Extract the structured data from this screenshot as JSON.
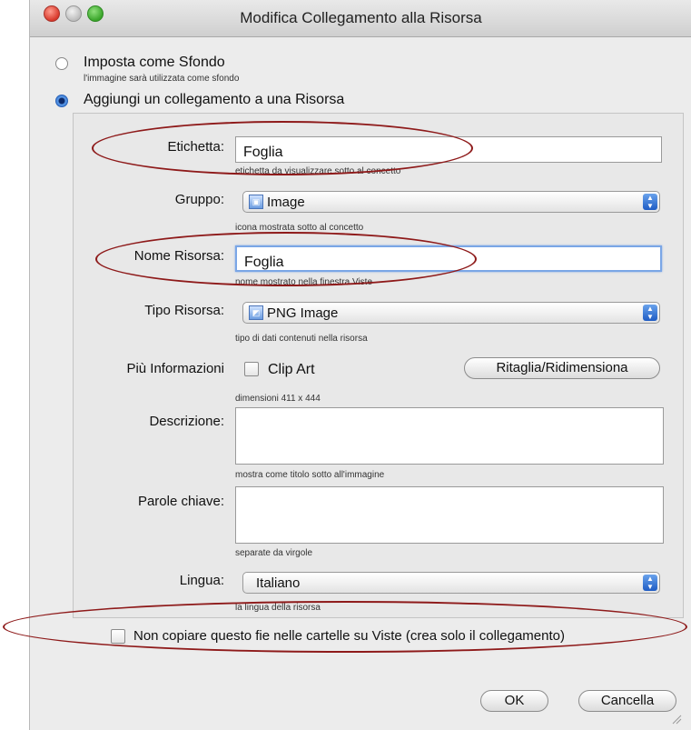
{
  "window": {
    "title": "Modifica Collegamento alla Risorsa"
  },
  "mode": {
    "background_option": {
      "label": "Imposta come Sfondo",
      "hint": "l'immagine sarà utilizzata come sfondo",
      "selected": false
    },
    "link_option": {
      "label": "Aggiungi un collegamento a una Risorsa",
      "selected": true
    }
  },
  "form": {
    "label_field": {
      "label": "Etichetta:",
      "value": "Foglia",
      "hint": "etichetta da visualizzare sotto al concetto"
    },
    "group_field": {
      "label": "Gruppo:",
      "value": "Image",
      "icon": "image-icon",
      "hint": "icona mostrata sotto al concetto"
    },
    "resource_name_field": {
      "label": "Nome Risorsa:",
      "value": "Foglia",
      "hint": "nome mostrato nella finestra Viste"
    },
    "resource_type_field": {
      "label": "Tipo Risorsa:",
      "value": "PNG Image",
      "icon": "png-file-icon",
      "hint": "tipo di dati contenuti nella risorsa"
    },
    "more_info": {
      "label": "Più Informazioni",
      "clipart_label": "Clip Art",
      "crop_button": "Ritaglia/Ridimensiona",
      "dimensions": "dimensioni 411 x 444"
    },
    "description_field": {
      "label": "Descrizione:",
      "value": "",
      "hint": "mostra come titolo sotto all'immagine"
    },
    "keywords_field": {
      "label": "Parole chiave:",
      "value": "",
      "hint": "separate da virgole"
    },
    "language_field": {
      "label": "Lingua:",
      "value": "Italiano",
      "hint": "la lingua della risorsa"
    }
  },
  "no_copy_checkbox": {
    "label": "Non copiare questo fie nelle cartelle su Viste (crea solo il collegamento)",
    "checked": false
  },
  "buttons": {
    "ok": "OK",
    "cancel": "Cancella"
  },
  "annotation_color": "#8e1a1a"
}
